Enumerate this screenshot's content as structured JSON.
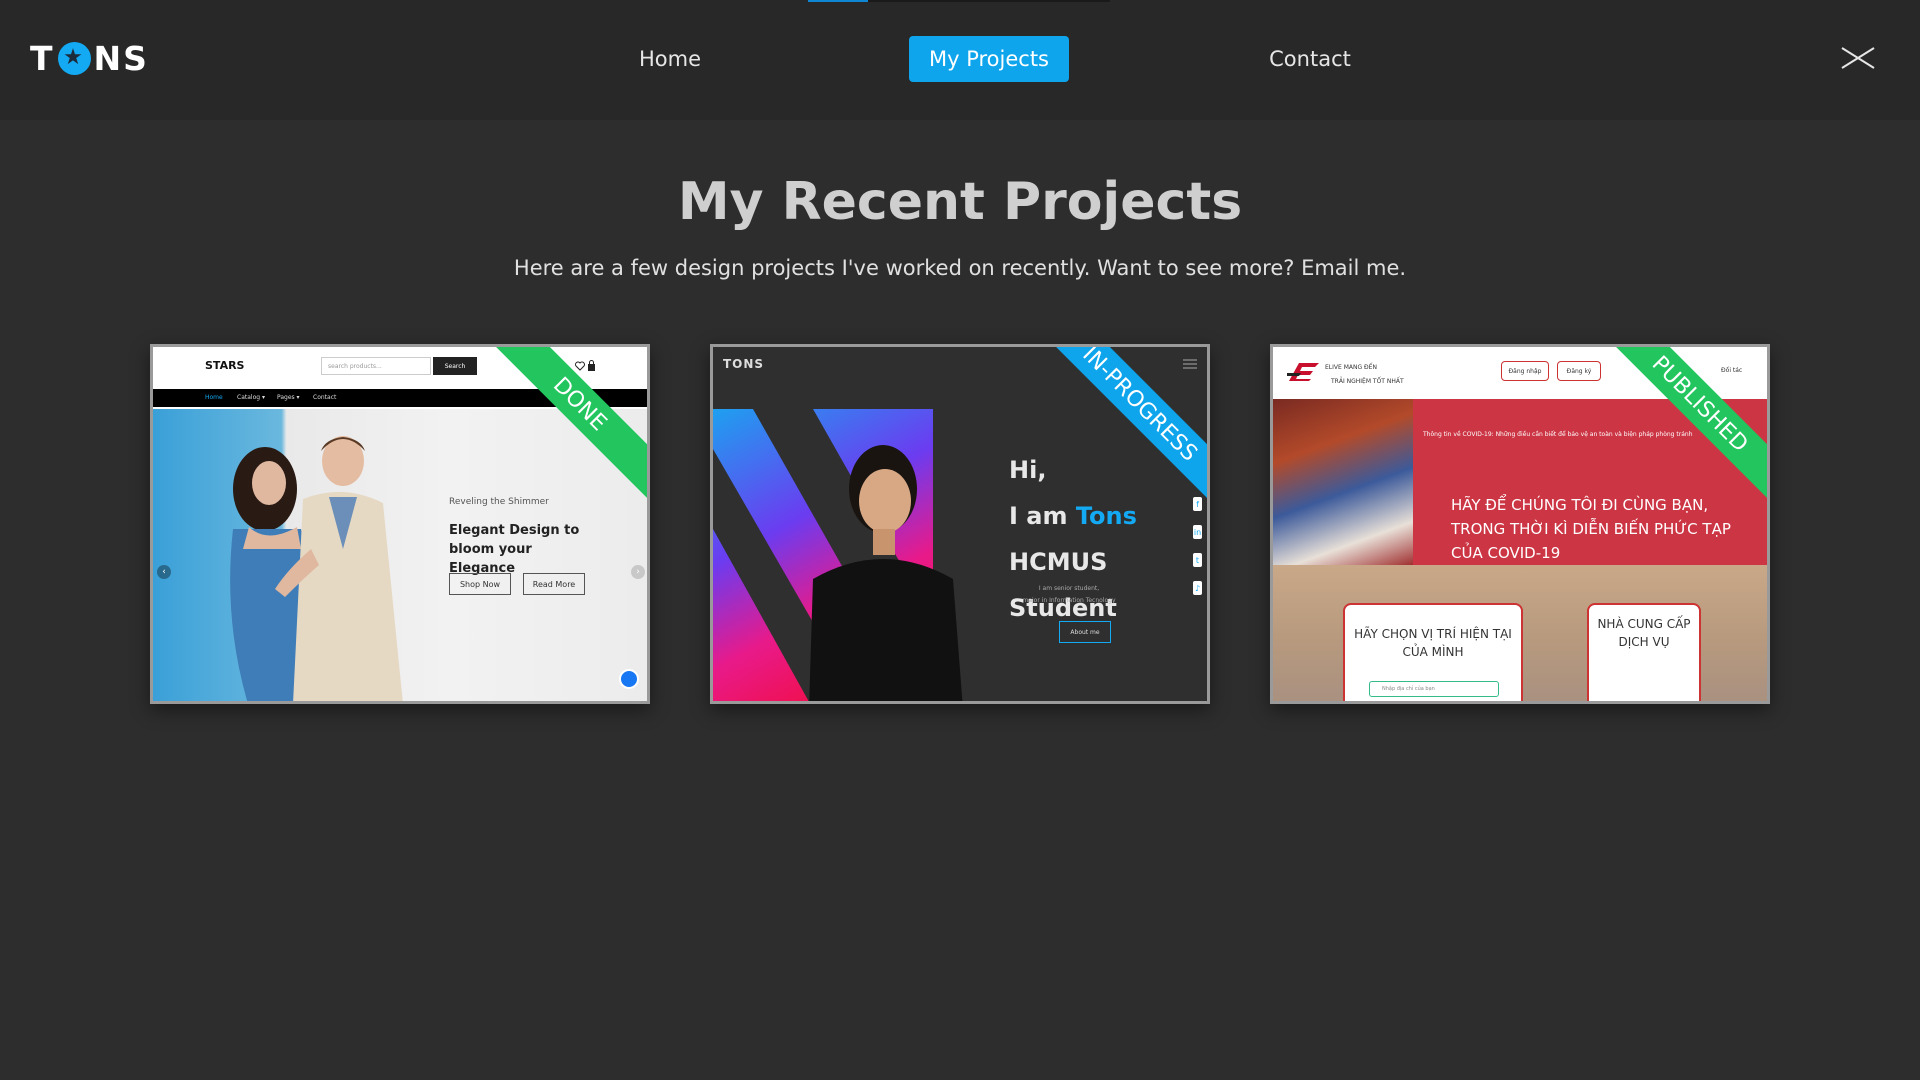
{
  "header": {
    "logo_left": "T",
    "logo_right": "NS",
    "nav": {
      "home": "Home",
      "projects": "My Projects",
      "contact": "Contact"
    },
    "active_tab": "My Projects",
    "accent_color": "#0ea5ec"
  },
  "main": {
    "title": "My Recent Projects",
    "subtitle": "Here are a few design projects I've worked on recently. Want to see more? Email me."
  },
  "projects": [
    {
      "status": "DONE",
      "status_color": "#22c55e",
      "preview": {
        "brand": "STARS",
        "search_placeholder": "search products...",
        "search_button": "Search",
        "nav": [
          "Home",
          "Catalog ▾",
          "Pages ▾",
          "Contact"
        ],
        "tagline": "Reveling the Shimmer",
        "headline": "Elegant Design to bloom your Elegance",
        "buttons": [
          "Shop Now",
          "Read More"
        ]
      }
    },
    {
      "status": "IN-PROGRESS",
      "status_color": "#0ea5ec",
      "preview": {
        "logo": "TONS",
        "line1": "Hi,",
        "line2_prefix": "I am ",
        "line2_name": "Tons",
        "line3": "HCMUS Student",
        "desc1": "I am senior student,",
        "desc2": "major in Information Tecnology",
        "about_button": "About me"
      }
    },
    {
      "status": "PUBLISHED",
      "status_color": "#22c55e",
      "preview": {
        "brand1": "ELIVE MANG ĐẾN",
        "brand2": "TRẢI NGHIỆM TỐT NHẤT",
        "login": "Đăng nhập",
        "register": "Đăng ký",
        "partner": "Đối tác",
        "notice": "Thông tin về COVID-19: Những điều cần biết để bảo vệ an toàn và biện pháp phòng tránh",
        "headline": "HÃY ĐỂ CHÚNG TÔI ĐI CÙNG BẠN, TRONG THỜI KÌ DIỄN BIẾN PHỨC TẠP CỦA COVID-19",
        "box1": "HÃY CHỌN VỊ TRÍ HIỆN TẠI CỦA MÌNH",
        "box2": "NHÀ CUNG CẤP DỊCH VỤ",
        "address_placeholder": "Nhập địa chỉ của bạn"
      }
    }
  ]
}
